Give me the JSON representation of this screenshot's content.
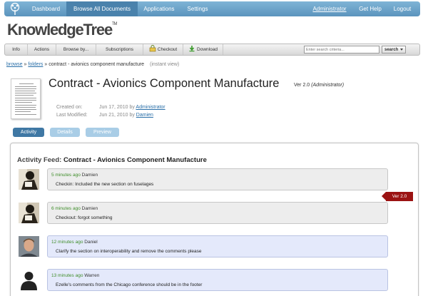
{
  "nav": {
    "items": [
      "Dashboard",
      "Browse All Documents",
      "Applications",
      "Settings"
    ],
    "right": [
      "Administrator",
      "Get Help",
      "Logout"
    ]
  },
  "brand": {
    "name": "KnowledgeTree",
    "tm": "TM"
  },
  "toolbar": {
    "items": [
      "Info",
      "Actions",
      "Browse by...",
      "Subscriptions",
      "Checkout",
      "Download"
    ],
    "search_placeholder": "Enter search criteria...",
    "search_button": "search"
  },
  "breadcrumb": {
    "browse": "browse",
    "sep": "»",
    "folders": "folders",
    "current": "contract - avionics component manufacture",
    "mode": "(instant view)"
  },
  "document": {
    "title": "Contract - Avionics Component Manufacture",
    "version": "Ver 2.0",
    "version_owner": "(Administrator)",
    "created_label": "Created on:",
    "created_date": "Jun 17, 2010",
    "created_by_word": "by",
    "created_by": "Administrator",
    "modified_label": "Last Modified:",
    "modified_date": "Jun 21, 2010",
    "modified_by_word": "by",
    "modified_by": "Damien"
  },
  "tabs": [
    "Activity",
    "Details",
    "Preview"
  ],
  "feed": {
    "label": "Activity Feed:",
    "doc": "Contract - Avionics Component Manufacture",
    "entries": [
      {
        "time": "5 minutes ago",
        "user": "Damien",
        "text": "Checkin: Included the new section on fuselages"
      },
      {
        "time": "6 minutes ago",
        "user": "Damien",
        "text": "Checkout: forgot something"
      },
      {
        "time": "12 minutes ago",
        "user": "Daniel",
        "text": "Clarify the section on interoperability and remove the comments please"
      },
      {
        "time": "13 minutes ago",
        "user": "Warren",
        "text": "Ezelle's comments from the Chicago conference should be in the footer"
      }
    ],
    "version_tag": "Ver 2.0"
  },
  "colors": {
    "nav": "#5b94bd",
    "tab_active": "#3f78a4",
    "tab_inactive": "#a9cde6",
    "version_tag": "#9b1313",
    "time_green": "#3f8d2a"
  },
  "icons": [
    "tree-logo-icon",
    "checkout-icon",
    "download-icon",
    "chevron-down-icon",
    "document-thumbnail"
  ]
}
